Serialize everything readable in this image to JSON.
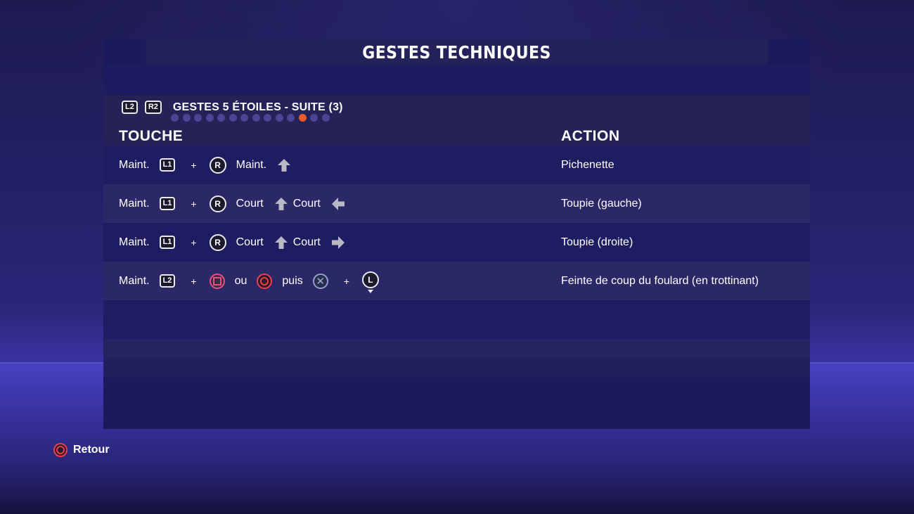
{
  "title": "GESTES TECHNIQUES",
  "tabs": {
    "left_trigger": "L2",
    "right_trigger": "R2",
    "section_name": "GESTES 5 ÉTOILES - SUITE (3)",
    "page_count": 14,
    "active_page": 12
  },
  "columns": {
    "touche": "TOUCHE",
    "action": "ACTION"
  },
  "rows": [
    {
      "inputs": [
        {
          "type": "text",
          "value": "Maint."
        },
        {
          "type": "key",
          "value": "L1"
        },
        {
          "type": "plus",
          "value": "+"
        },
        {
          "type": "stick",
          "value": "R"
        },
        {
          "type": "text",
          "value": "Maint."
        },
        {
          "type": "arrow",
          "value": "arrow-up-icon"
        }
      ],
      "action": "Pichenette"
    },
    {
      "inputs": [
        {
          "type": "text",
          "value": "Maint."
        },
        {
          "type": "key",
          "value": "L1"
        },
        {
          "type": "plus",
          "value": "+"
        },
        {
          "type": "stick",
          "value": "R"
        },
        {
          "type": "text",
          "value": "Court"
        },
        {
          "type": "arrow",
          "value": "arrow-up-icon"
        },
        {
          "type": "text",
          "value": "Court"
        },
        {
          "type": "arrow",
          "value": "arrow-left-icon"
        }
      ],
      "action": "Toupie (gauche)"
    },
    {
      "inputs": [
        {
          "type": "text",
          "value": "Maint."
        },
        {
          "type": "key",
          "value": "L1"
        },
        {
          "type": "plus",
          "value": "+"
        },
        {
          "type": "stick",
          "value": "R"
        },
        {
          "type": "text",
          "value": "Court"
        },
        {
          "type": "arrow",
          "value": "arrow-up-icon"
        },
        {
          "type": "text",
          "value": "Court"
        },
        {
          "type": "arrow",
          "value": "arrow-right-icon"
        }
      ],
      "action": "Toupie (droite)"
    },
    {
      "inputs": [
        {
          "type": "text",
          "value": "Maint."
        },
        {
          "type": "key",
          "value": "L2"
        },
        {
          "type": "plus",
          "value": "+"
        },
        {
          "type": "square",
          "value": "square-button-icon"
        },
        {
          "type": "text",
          "value": "ou"
        },
        {
          "type": "circle",
          "value": "circle-button-icon"
        },
        {
          "type": "text",
          "value": "puis"
        },
        {
          "type": "cross",
          "value": "cross-button-icon"
        },
        {
          "type": "plus",
          "value": "+"
        },
        {
          "type": "lstick",
          "value": "L"
        }
      ],
      "action": "Feinte de coup du foulard (en trottinant)"
    }
  ],
  "footer": {
    "back_icon": "circle-button-icon",
    "back_label": "Retour"
  },
  "colors": {
    "accent_dot": "#ea5a2a",
    "inactive_dot": "#4c4596",
    "panel": "#1c1a5c"
  }
}
